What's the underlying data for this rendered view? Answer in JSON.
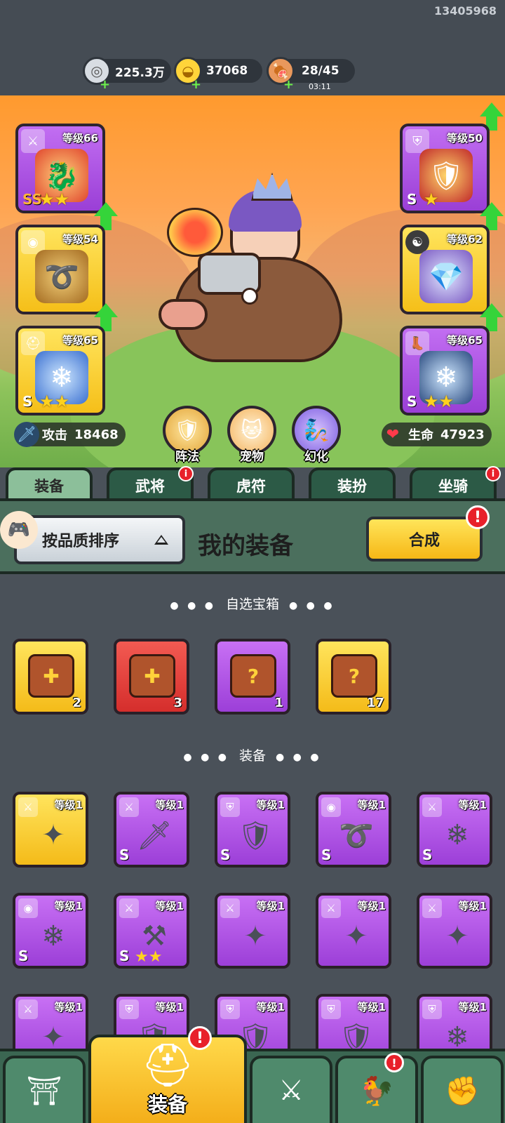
{
  "header": {
    "user_id": "13405968",
    "resources": [
      {
        "icon": "silver-coin-icon",
        "value": "225.3万"
      },
      {
        "icon": "gold-ingot-icon",
        "value": "37068"
      },
      {
        "icon": "meat-icon",
        "value": "28/45",
        "timer": "03:11"
      }
    ]
  },
  "hero_slots": [
    {
      "side": "left",
      "category": "weapon-icon",
      "level": "等级66",
      "grade": "SS",
      "stars": "★★",
      "color": "purple",
      "upgrade": true
    },
    {
      "side": "left",
      "category": "medal-icon",
      "level": "等级54",
      "grade": "",
      "stars": "",
      "color": "gold",
      "upgrade": true
    },
    {
      "side": "left",
      "category": "helmet-icon",
      "level": "等级65",
      "grade": "S",
      "stars": "★★",
      "color": "gold",
      "upgrade": false
    },
    {
      "side": "right",
      "category": "armor-icon",
      "level": "等级50",
      "grade": "S",
      "stars": "★",
      "color": "purple",
      "upgrade": true
    },
    {
      "side": "right",
      "category": "yinyang-icon",
      "level": "等级62",
      "grade": "",
      "stars": "",
      "color": "gold",
      "upgrade": true
    },
    {
      "side": "right",
      "category": "boot-icon",
      "level": "等级65",
      "grade": "S",
      "stars": "★★",
      "color": "purple",
      "upgrade": true
    }
  ],
  "stats": {
    "attack_label": "攻击",
    "attack_value": "18468",
    "hp_label": "生命",
    "hp_value": "47923"
  },
  "hero_buttons": [
    {
      "label": "阵法",
      "icon": "formation-icon"
    },
    {
      "label": "宠物",
      "icon": "pet-cat-icon"
    },
    {
      "label": "幻化",
      "icon": "transform-icon"
    }
  ],
  "tabs": [
    {
      "label": "装备",
      "active": true,
      "badge": false
    },
    {
      "label": "武将",
      "active": false,
      "badge": true
    },
    {
      "label": "虎符",
      "active": false,
      "badge": false
    },
    {
      "label": "装扮",
      "active": false,
      "badge": false
    },
    {
      "label": "坐骑",
      "active": false,
      "badge": true
    }
  ],
  "panel": {
    "sort_label": "按品质排序",
    "title": "我的装备",
    "synth_label": "合成"
  },
  "sections": {
    "chests_title": "自选宝箱",
    "equipment_title": "装备"
  },
  "chests": [
    {
      "color": "gold",
      "count": "2",
      "icon": "dice-chest-icon"
    },
    {
      "color": "red",
      "count": "3",
      "icon": "dice-chest-icon"
    },
    {
      "color": "purple",
      "count": "1",
      "icon": "mystery-chest-icon"
    },
    {
      "color": "gold",
      "count": "17",
      "icon": "mystery-chest-icon"
    }
  ],
  "equipment": [
    {
      "color": "gold",
      "category": "weapon-icon",
      "level": "等级1",
      "grade": "",
      "stars": "",
      "art": "shuriken-icon"
    },
    {
      "color": "purple",
      "category": "weapon-icon",
      "level": "等级1",
      "grade": "S",
      "stars": "",
      "art": "blade-icon"
    },
    {
      "color": "purple",
      "category": "armor-icon",
      "level": "等级1",
      "grade": "S",
      "stars": "",
      "art": "armor-icon"
    },
    {
      "color": "purple",
      "category": "medal-icon",
      "level": "等级1",
      "grade": "S",
      "stars": "",
      "art": "amulet-icon"
    },
    {
      "color": "purple",
      "category": "weapon-icon",
      "level": "等级1",
      "grade": "S",
      "stars": "",
      "art": "ice-sword-icon"
    },
    {
      "color": "purple",
      "category": "medal-icon",
      "level": "等级1",
      "grade": "S",
      "stars": "",
      "art": "ice-amulet-icon"
    },
    {
      "color": "purple",
      "category": "weapon-icon",
      "level": "等级1",
      "grade": "S",
      "stars": "★★",
      "art": "halberd-icon"
    },
    {
      "color": "purple",
      "category": "weapon-icon",
      "level": "等级1",
      "grade": "",
      "stars": "",
      "art": "shuriken-icon"
    },
    {
      "color": "purple",
      "category": "weapon-icon",
      "level": "等级1",
      "grade": "",
      "stars": "",
      "art": "shuriken-icon"
    },
    {
      "color": "purple",
      "category": "weapon-icon",
      "level": "等级1",
      "grade": "",
      "stars": "",
      "art": "shuriken-icon"
    },
    {
      "color": "purple",
      "category": "weapon-icon",
      "level": "等级1",
      "grade": "",
      "stars": "",
      "art": "shuriken-icon"
    },
    {
      "color": "purple",
      "category": "armor-icon",
      "level": "等级1",
      "grade": "",
      "stars": "",
      "art": "gold-armor-icon"
    },
    {
      "color": "purple",
      "category": "armor-icon",
      "level": "等级1",
      "grade": "",
      "stars": "",
      "art": "gold-armor-icon"
    },
    {
      "color": "purple",
      "category": "armor-icon",
      "level": "等级1",
      "grade": "",
      "stars": "",
      "art": "gold-armor-icon"
    },
    {
      "color": "purple",
      "category": "armor-icon",
      "level": "等级1",
      "grade": "",
      "stars": "",
      "art": "ice-armor-icon"
    }
  ],
  "bottom_nav": [
    {
      "icon": "city-gate-icon",
      "label": "",
      "active": false,
      "badge": false
    },
    {
      "icon": "helmet-icon",
      "label": "装备",
      "active": true,
      "badge": true
    },
    {
      "icon": "crossed-swords-icon",
      "label": "",
      "active": false,
      "badge": false
    },
    {
      "icon": "rooster-icon",
      "label": "",
      "active": false,
      "badge": true
    },
    {
      "icon": "power-fist-icon",
      "label": "",
      "active": false,
      "badge": false
    }
  ]
}
